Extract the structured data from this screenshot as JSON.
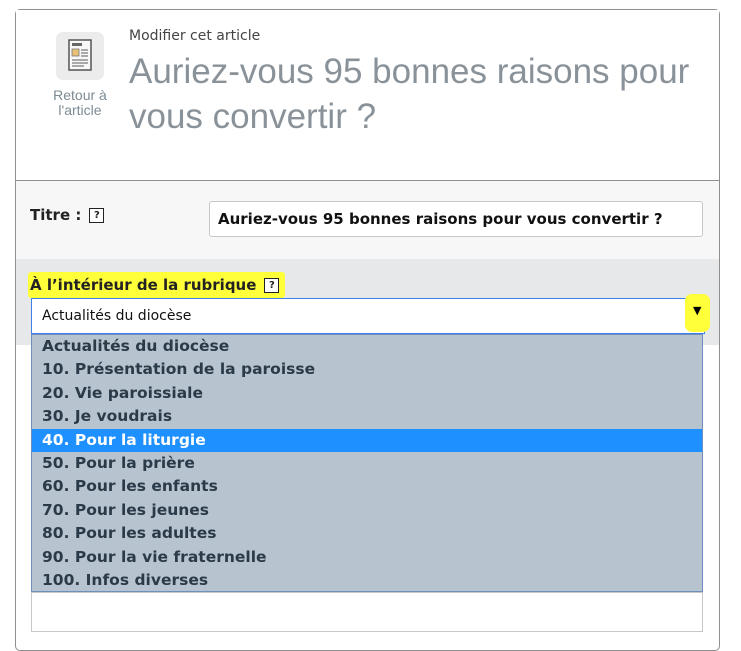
{
  "header": {
    "back_label_line1": "Retour à",
    "back_label_line2": "l'article",
    "back_icon": "article-icon",
    "subtitle": "Modifier cet article",
    "title": "Auriez-vous 95 bonnes raisons pour vous convertir ?"
  },
  "form": {
    "title_label": "Titre :",
    "title_help": "?",
    "title_value": "Auriez-vous 95 bonnes raisons pour vous convertir ?",
    "rubrique_label": "À l’intérieur de la rubrique",
    "rubrique_help": "?",
    "rubrique_selected": "Actualités du diocèse",
    "dropdown_arrow": "▼",
    "options": [
      "Actualités du diocèse",
      "10. Présentation de la paroisse",
      "20. Vie paroissiale",
      "30. Je voudrais",
      "40. Pour la liturgie",
      "50. Pour la prière",
      "60. Pour les enfants",
      "70. Pour les jeunes",
      "80. Pour les adultes",
      "90. Pour la vie fraternelle",
      "100. Infos diverses"
    ],
    "highlighted_option_index": 4
  },
  "colors": {
    "highlight_yellow": "#ffff3a",
    "selected_option": "#1e90ff",
    "dropdown_bg": "#b7c3cf",
    "title_gray": "#8a9299"
  }
}
